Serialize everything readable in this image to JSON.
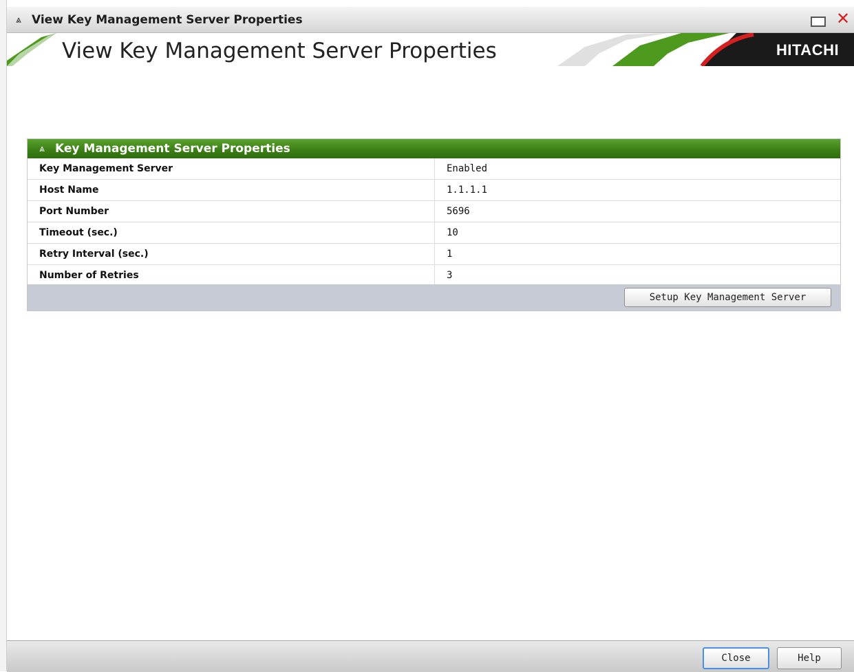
{
  "window": {
    "title": "View Key Management Server Properties",
    "collapse_glyph": "»",
    "maximize_icon": "maximize-icon",
    "close_icon": "close-icon"
  },
  "banner": {
    "title": "View Key Management Server Properties",
    "brand": "HITACHI"
  },
  "panel": {
    "title": "Key Management Server Properties",
    "rows": [
      {
        "label": "Key Management Server",
        "value": "Enabled"
      },
      {
        "label": "Host Name",
        "value": "1.1.1.1"
      },
      {
        "label": "Port Number",
        "value": "5696"
      },
      {
        "label": "Timeout (sec.)",
        "value": "10"
      },
      {
        "label": "Retry Interval (sec.)",
        "value": "1"
      },
      {
        "label": "Number of Retries",
        "value": "3"
      }
    ],
    "setup_button": "Setup Key Management Server"
  },
  "footer": {
    "close_button": "Close",
    "help_button": "Help"
  },
  "colors": {
    "panel_header": "#3b7d16",
    "accent_green": "#4e9a1f",
    "accent_red": "#d42020",
    "brand_bg": "#1a1a1a",
    "footer_bar": "#c6cbd6"
  }
}
